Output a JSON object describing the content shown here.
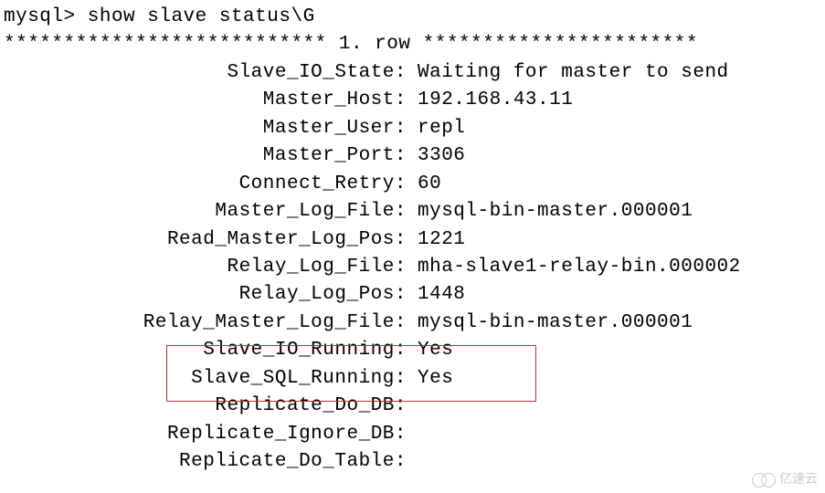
{
  "command": {
    "prompt": "mysql>",
    "text": "show slave status\\G"
  },
  "separator": {
    "left": "***************************",
    "center": "1. row",
    "right": "***********************"
  },
  "status": [
    {
      "label": "Slave_IO_State:",
      "value": "Waiting for master to send"
    },
    {
      "label": "Master_Host:",
      "value": "192.168.43.11"
    },
    {
      "label": "Master_User:",
      "value": "repl"
    },
    {
      "label": "Master_Port:",
      "value": "3306"
    },
    {
      "label": "Connect_Retry:",
      "value": "60"
    },
    {
      "label": "Master_Log_File:",
      "value": "mysql-bin-master.000001"
    },
    {
      "label": "Read_Master_Log_Pos:",
      "value": "1221"
    },
    {
      "label": "Relay_Log_File:",
      "value": "mha-slave1-relay-bin.000002"
    },
    {
      "label": "Relay_Log_Pos:",
      "value": "1448"
    },
    {
      "label": "Relay_Master_Log_File:",
      "value": "mysql-bin-master.000001"
    },
    {
      "label": "Slave_IO_Running:",
      "value": "Yes"
    },
    {
      "label": "Slave_SQL_Running:",
      "value": "Yes"
    },
    {
      "label": "Replicate_Do_DB:",
      "value": ""
    },
    {
      "label": "Replicate_Ignore_DB:",
      "value": ""
    },
    {
      "label": "Replicate_Do_Table:",
      "value": ""
    }
  ],
  "watermark": "亿速云"
}
